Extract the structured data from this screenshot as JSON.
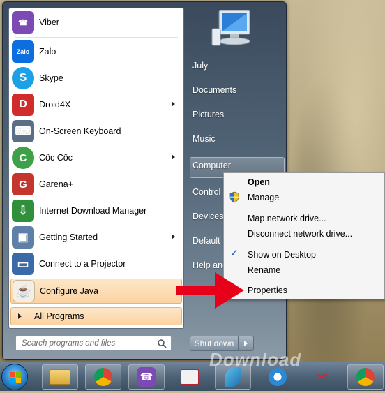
{
  "programs": [
    {
      "label": "Viber",
      "icon": "viber-icon",
      "color": "#7d4ab5",
      "glyph": "☎",
      "submenu": false
    },
    {
      "label": "Zalo",
      "icon": "zalo-icon",
      "color": "#0d6ee0",
      "glyph": "Zalo",
      "submenu": false
    },
    {
      "label": "Skype",
      "icon": "skype-icon",
      "color": "#1da1e6",
      "glyph": "S",
      "submenu": false
    },
    {
      "label": "Droid4X",
      "icon": "droid4x-icon",
      "color": "#d22b2b",
      "glyph": "D",
      "submenu": true
    },
    {
      "label": "On-Screen Keyboard",
      "icon": "keyboard-icon",
      "color": "#5a6f86",
      "glyph": "⌨",
      "submenu": false
    },
    {
      "label": "Cốc Cốc",
      "icon": "coccoc-icon",
      "color": "#3fa04a",
      "glyph": "C",
      "submenu": true
    },
    {
      "label": "Garena+",
      "icon": "garena-icon",
      "color": "#c4352d",
      "glyph": "G",
      "submenu": false
    },
    {
      "label": "Internet Download Manager",
      "icon": "idm-icon",
      "color": "#2f8f3b",
      "glyph": "⇩",
      "submenu": false
    },
    {
      "label": "Getting Started",
      "icon": "getting-started-icon",
      "color": "#5d7fa8",
      "glyph": "▣",
      "submenu": true
    },
    {
      "label": "Connect to a Projector",
      "icon": "projector-icon",
      "color": "#3a6aa8",
      "glyph": "▭",
      "submenu": false
    },
    {
      "label": "Configure Java",
      "icon": "java-icon",
      "color": "#e2e2e2",
      "glyph": "☕",
      "submenu": false
    }
  ],
  "all_programs": "All Programs",
  "search_placeholder": "Search programs and files",
  "right_items": [
    "July",
    "Documents",
    "Pictures",
    "Music",
    "Computer",
    "Control",
    "Devices",
    "Default P",
    "Help and"
  ],
  "shutdown_label": "Shut down",
  "context_menu": {
    "items": [
      "Open",
      "Manage",
      "Map network drive...",
      "Disconnect network drive...",
      "Show on Desktop",
      "Rename",
      "Properties"
    ]
  },
  "watermark": "Download",
  "accent": "#e8001a"
}
